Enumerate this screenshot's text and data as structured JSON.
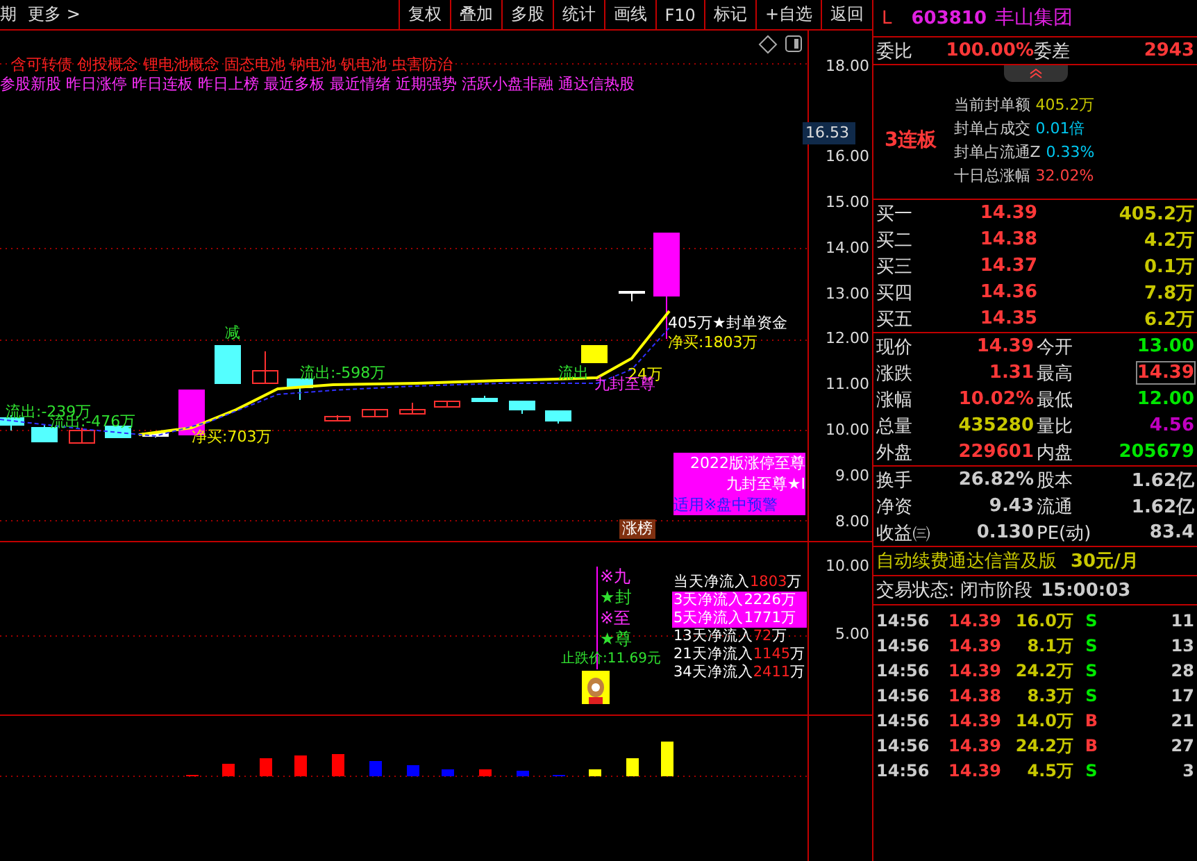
{
  "toolbar": {
    "left": [
      "期",
      "更多 >"
    ],
    "buttons": [
      "复权",
      "叠加",
      "多股",
      "统计",
      "画线",
      "F10",
      "标记",
      "+自选",
      "返回"
    ]
  },
  "chart": {
    "concepts": "含可转债 创投概念 锂电池概念 固态电池 钠电池 钒电池 虫害防治",
    "tags": "参股新股 昨日涨停 昨日连板 昨日上榜 最近多板 最近情绪 近期强势 活跃小盘非融 通达信热股",
    "price_axis": [
      "18.00",
      "16.00",
      "15.00",
      "14.00",
      "13.00",
      "12.00",
      "11.00",
      "10.00",
      "9.00",
      "8.00"
    ],
    "current_price": "16.53",
    "annotations": [
      {
        "text": "流出:-239万",
        "kind": "outflow"
      },
      {
        "text": "流出:-476万",
        "kind": "outflow"
      },
      {
        "text": "净买:703万",
        "kind": "buy"
      },
      {
        "text": "减",
        "kind": "outflow"
      },
      {
        "text": "流出:-598万",
        "kind": "outflow"
      },
      {
        "text": "流出",
        "kind": "outflow"
      },
      {
        "text": "24万",
        "kind": "buy"
      },
      {
        "text": "九封至尊",
        "kind": "signal"
      },
      {
        "text": "405万★封单资金",
        "kind": "seal"
      },
      {
        "text": "净买:1803万",
        "kind": "buy"
      }
    ],
    "promo_box": {
      "title": "2022版涨停至尊",
      "subtitle": "九封至尊★I",
      "note": "适用※盘中预警"
    },
    "rank_badge": "涨榜"
  },
  "indicator": {
    "axis": [
      "10.00",
      "5.00"
    ],
    "signals": [
      {
        "mark": "※",
        "char": "九",
        "kind": "hollow"
      },
      {
        "mark": "★",
        "char": "封",
        "kind": "star"
      },
      {
        "mark": "※",
        "char": "至",
        "kind": "hollow"
      },
      {
        "mark": "★",
        "char": "尊",
        "kind": "star"
      }
    ],
    "stop_price": "止跌价:11.69元",
    "flows": [
      {
        "label": "当天净流入",
        "value": "1803",
        "unit": "万",
        "highlighted": false
      },
      {
        "label": "3天净流入",
        "value": "2226",
        "unit": "万",
        "highlighted": true
      },
      {
        "label": "5天净流入",
        "value": "1771",
        "unit": "万",
        "highlighted": true
      },
      {
        "label": "13天净流入",
        "value": "72",
        "unit": "万",
        "highlighted": false
      },
      {
        "label": "21天净流入",
        "value": "1145",
        "unit": "万",
        "highlighted": false
      },
      {
        "label": "34天净流入",
        "value": "2411",
        "unit": "万",
        "highlighted": false
      }
    ]
  },
  "quote": {
    "market": "L",
    "code": "603810",
    "name": "丰山集团",
    "ratio": {
      "label": "委比",
      "value": "100.00%",
      "diff_label": "委差",
      "diff": "2943"
    },
    "streak": "3连板",
    "seal_info": [
      {
        "label": "当前封单额",
        "value": "405.2万",
        "color": "#c8c800"
      },
      {
        "label": "封单占成交",
        "value": "0.01倍",
        "color": "#00c8f0"
      },
      {
        "label": "封单占流通Z",
        "value": "0.33%",
        "color": "#00c8f0"
      },
      {
        "label": "十日总涨幅",
        "value": "32.02%",
        "color": "#ff4040"
      }
    ],
    "bids": [
      {
        "label": "买一",
        "price": "14.39",
        "volume": "405.2万"
      },
      {
        "label": "买二",
        "price": "14.38",
        "volume": "4.2万"
      },
      {
        "label": "买三",
        "price": "14.37",
        "volume": "0.1万"
      },
      {
        "label": "买四",
        "price": "14.36",
        "volume": "7.8万"
      },
      {
        "label": "买五",
        "price": "14.35",
        "volume": "6.2万"
      }
    ],
    "stats": [
      {
        "label": "现价",
        "value": "14.39",
        "color": "#ff3838",
        "boxed": false
      },
      {
        "label": "今开",
        "value": "13.00",
        "color": "#00e600",
        "boxed": false
      },
      {
        "label": "涨跌",
        "value": "1.31",
        "color": "#ff3838",
        "boxed": false
      },
      {
        "label": "最高",
        "value": "14.39",
        "color": "#ff3838",
        "boxed": true
      },
      {
        "label": "涨幅",
        "value": "10.02%",
        "color": "#ff3838",
        "boxed": false
      },
      {
        "label": "最低",
        "value": "12.00",
        "color": "#00e600",
        "boxed": false
      },
      {
        "label": "总量",
        "value": "435280",
        "color": "#c8c800",
        "boxed": false
      },
      {
        "label": "量比",
        "value": "4.56",
        "color": "#c000c0",
        "boxed": false
      },
      {
        "label": "外盘",
        "value": "229601",
        "color": "#ff3838",
        "boxed": false
      },
      {
        "label": "内盘",
        "value": "205679",
        "color": "#00e600",
        "boxed": false
      }
    ],
    "finance": [
      {
        "label": "换手",
        "value": "26.82%"
      },
      {
        "label": "股本",
        "value": "1.62亿"
      },
      {
        "label": "净资",
        "value": "9.43"
      },
      {
        "label": "流通",
        "value": "1.62亿"
      },
      {
        "label": "收益㈢",
        "value": "0.130"
      },
      {
        "label": "PE(动)",
        "value": "83.4"
      }
    ],
    "ad": {
      "text": "自动续费通达信普及版",
      "price": "30元/月"
    },
    "status": {
      "label": "交易状态: 闭市阶段",
      "time": "15:00:03"
    },
    "trades": [
      {
        "time": "14:56",
        "price": "14.39",
        "volume": "16.0万",
        "side": "S",
        "count": "11"
      },
      {
        "time": "14:56",
        "price": "14.39",
        "volume": "8.1万",
        "side": "S",
        "count": "13"
      },
      {
        "time": "14:56",
        "price": "14.39",
        "volume": "24.2万",
        "side": "S",
        "count": "28"
      },
      {
        "time": "14:56",
        "price": "14.38",
        "volume": "8.3万",
        "side": "S",
        "count": "17"
      },
      {
        "time": "14:56",
        "price": "14.39",
        "volume": "14.0万",
        "side": "B",
        "count": "21"
      },
      {
        "time": "14:56",
        "price": "14.39",
        "volume": "24.2万",
        "side": "B",
        "count": "27"
      },
      {
        "time": "14:56",
        "price": "14.39",
        "volume": "4.5万",
        "side": "S",
        "count": "3"
      }
    ]
  }
}
